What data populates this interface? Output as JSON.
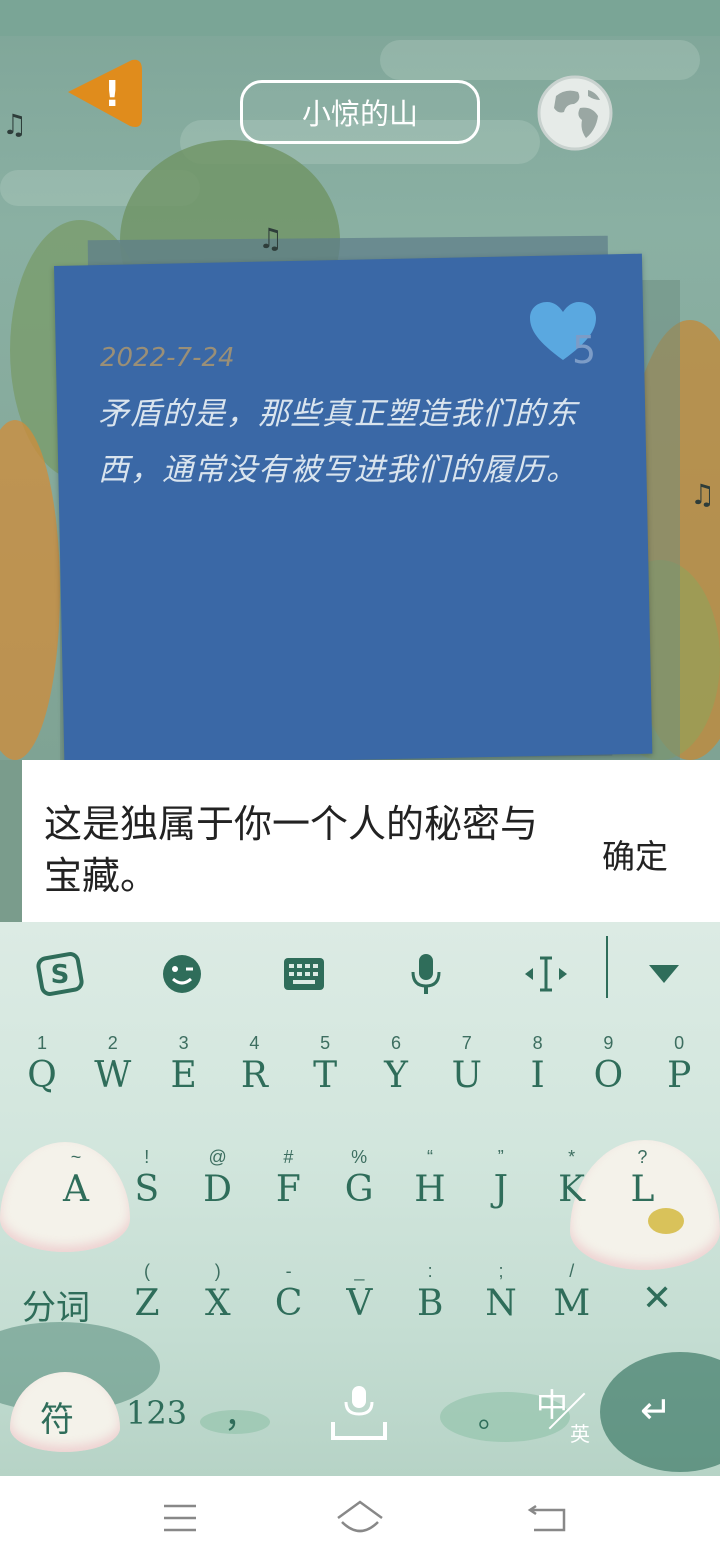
{
  "header": {
    "title": "小惊的山",
    "warning_glyph": "!",
    "globe_icon": "globe-icon",
    "music_glyph": "♫"
  },
  "note": {
    "date": "2022-7-24",
    "text": "矛盾的是，那些真正塑造我们的东西，通常没有被写进我们的履历。",
    "likes": "5",
    "color": "#3a68a6"
  },
  "input": {
    "text": "这是独属于你一个人的秘密与宝藏。",
    "confirm_label": "确定"
  },
  "keyboard": {
    "toolbar": [
      "sogou-logo-icon",
      "emoji-icon",
      "keyboard-icon",
      "microphone-icon",
      "cursor-move-icon",
      "collapse-icon"
    ],
    "row1": [
      {
        "hint": "1",
        "key": "Q"
      },
      {
        "hint": "2",
        "key": "W"
      },
      {
        "hint": "3",
        "key": "E"
      },
      {
        "hint": "4",
        "key": "R"
      },
      {
        "hint": "5",
        "key": "T"
      },
      {
        "hint": "6",
        "key": "Y"
      },
      {
        "hint": "7",
        "key": "U"
      },
      {
        "hint": "8",
        "key": "I"
      },
      {
        "hint": "9",
        "key": "O"
      },
      {
        "hint": "0",
        "key": "P"
      }
    ],
    "row2": [
      {
        "hint": "~",
        "key": "A"
      },
      {
        "hint": "!",
        "key": "S"
      },
      {
        "hint": "@",
        "key": "D"
      },
      {
        "hint": "#",
        "key": "F"
      },
      {
        "hint": "%",
        "key": "G"
      },
      {
        "hint": "“",
        "key": "H"
      },
      {
        "hint": "”",
        "key": "J"
      },
      {
        "hint": "*",
        "key": "K"
      },
      {
        "hint": "?",
        "key": "L"
      }
    ],
    "row3": [
      {
        "hint": "(",
        "key": "Z"
      },
      {
        "hint": ")",
        "key": "X"
      },
      {
        "hint": "-",
        "key": "C"
      },
      {
        "hint": "_",
        "key": "V"
      },
      {
        "hint": ":",
        "key": "B"
      },
      {
        "hint": ";",
        "key": "N"
      },
      {
        "hint": "/",
        "key": "M"
      }
    ],
    "segment_label": "分词",
    "delete_glyph": "✕",
    "symbol_label": "符",
    "number_label": "123",
    "comma": "，",
    "period": "。",
    "lang_main": "中",
    "lang_sub": "英",
    "enter_glyph": "↵"
  },
  "colors": {
    "accent": "#2f6d5a",
    "warning": "#e08c1c"
  }
}
